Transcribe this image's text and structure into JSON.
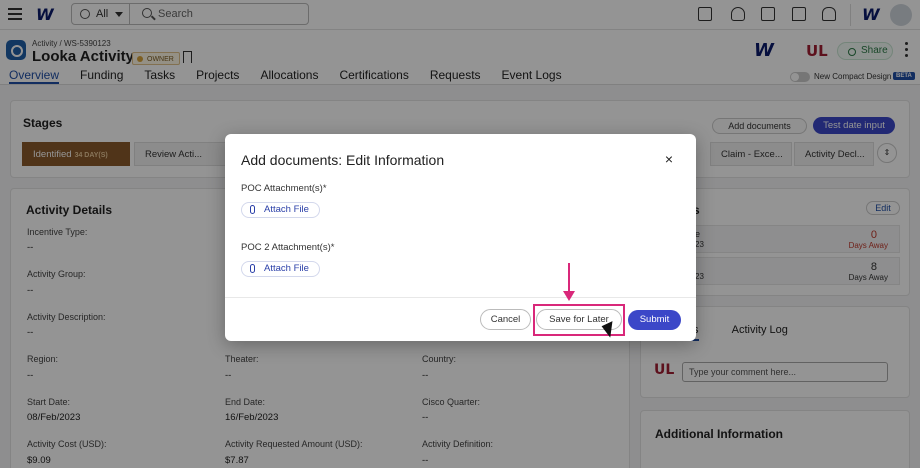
{
  "topbar": {
    "logo": "W",
    "search_scope": "All",
    "search_placeholder": "Search",
    "logo_right": "W",
    "icons": [
      "copy-icon",
      "hand-icon",
      "checkbox-icon",
      "chat-icon",
      "bell-icon"
    ]
  },
  "header": {
    "breadcrumb": "Activity / WS-5390123",
    "title": "Looka Activity",
    "owner_badge": "OWNER",
    "brand_w": "W",
    "brand_ul": "UL",
    "share_label": "Share",
    "compact_label": "New Compact Design",
    "beta_label": "BETA",
    "tabs": [
      "Overview",
      "Funding",
      "Tasks",
      "Projects",
      "Allocations",
      "Certifications",
      "Requests",
      "Event Logs"
    ]
  },
  "stages": {
    "title": "Stages",
    "add_documents": "Add documents",
    "test_date": "Test date input",
    "first_stage": "Identified",
    "first_stage_days": "34 DAY(S)",
    "items": [
      "Review Acti...",
      "Claim - Exce...",
      "Activity Decl..."
    ]
  },
  "activity_details": {
    "title": "Activity Details",
    "fields": [
      {
        "label": "Incentive Type:",
        "value": "--"
      },
      {
        "label": "Activity Group:",
        "value": "--"
      },
      {
        "label": "Activity Description:",
        "value": "--"
      },
      {
        "label": "Region:",
        "value": "--"
      },
      {
        "label": "Theater:",
        "value": "--"
      },
      {
        "label": "Country:",
        "value": "--"
      },
      {
        "label": "Start Date:",
        "value": "08/Feb/2023"
      },
      {
        "label": "End Date:",
        "value": "16/Feb/2023"
      },
      {
        "label": "Cisco Quarter:",
        "value": "--"
      },
      {
        "label": "Activity Cost (USD):",
        "value": "$9.09"
      },
      {
        "label": "Activity Requested Amount (USD):",
        "value": "$7.87"
      },
      {
        "label": "Activity Definition:",
        "value": "--"
      }
    ]
  },
  "side_panel": {
    "title_fragment": "s",
    "edit": "Edit",
    "rows": [
      {
        "left": "e",
        "left_sub": "23",
        "num": "0",
        "sub": "Days Away",
        "color": "#c0392b"
      },
      {
        "left": "",
        "left_sub": "23",
        "num": "8",
        "sub": "Days Away",
        "color": "#333333"
      }
    ],
    "tab_fragment": "ts",
    "activity_log": "Activity Log",
    "comment_placeholder": "Type your comment here...",
    "additional_info": "Additional Information"
  },
  "modal": {
    "title": "Add documents: Edit Information",
    "close": "×",
    "poc_label": "POC Attachment(s)*",
    "poc2_label": "POC 2 Attachment(s)*",
    "attach_label": "Attach File",
    "cancel": "Cancel",
    "save_later": "Save for Later",
    "submit": "Submit"
  }
}
